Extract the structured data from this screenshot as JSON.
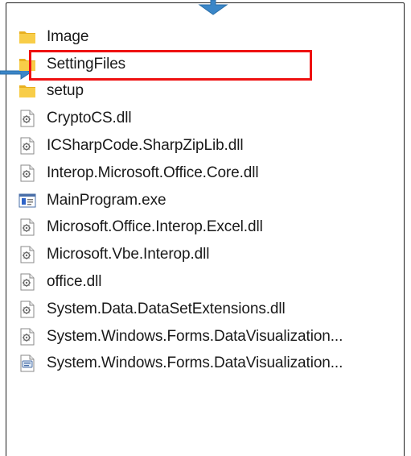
{
  "file_list": {
    "items": [
      {
        "label": "Image",
        "icon": "folder-icon",
        "type": "folder"
      },
      {
        "label": "SettingFiles",
        "icon": "folder-icon",
        "type": "folder"
      },
      {
        "label": "setup",
        "icon": "folder-icon",
        "type": "folder"
      },
      {
        "label": "CryptoCS.dll",
        "icon": "dll-file-icon",
        "type": "dll"
      },
      {
        "label": "ICSharpCode.SharpZipLib.dll",
        "icon": "dll-file-icon",
        "type": "dll"
      },
      {
        "label": "Interop.Microsoft.Office.Core.dll",
        "icon": "dll-file-icon",
        "type": "dll"
      },
      {
        "label": "MainProgram.exe",
        "icon": "exe-file-icon",
        "type": "exe"
      },
      {
        "label": "Microsoft.Office.Interop.Excel.dll",
        "icon": "dll-file-icon",
        "type": "dll"
      },
      {
        "label": "Microsoft.Vbe.Interop.dll",
        "icon": "dll-file-icon",
        "type": "dll"
      },
      {
        "label": "office.dll",
        "icon": "dll-file-icon",
        "type": "dll"
      },
      {
        "label": "System.Data.DataSetExtensions.dll",
        "icon": "dll-file-icon",
        "type": "dll"
      },
      {
        "label": "System.Windows.Forms.DataVisualization...",
        "icon": "dll-file-icon",
        "type": "dll"
      },
      {
        "label": "System.Windows.Forms.DataVisualization...",
        "icon": "config-file-icon",
        "type": "config"
      }
    ]
  },
  "highlighted_item": "SettingFiles",
  "colors": {
    "highlight": "#ee1111",
    "arrow": "#3a86c8",
    "folder": "#f4c430"
  }
}
